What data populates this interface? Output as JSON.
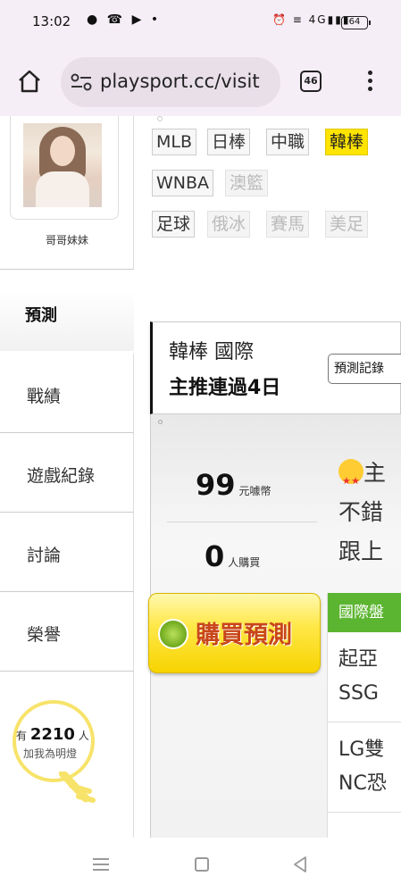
{
  "status_bar": {
    "time": "13:02",
    "left_icons": [
      "chat-icon",
      "missed-call-icon",
      "youtube-icon",
      "dot-icon"
    ],
    "right_icons": [
      "alarm-icon",
      "volte-icon",
      "signal-icon"
    ],
    "network": "4G",
    "battery": "64"
  },
  "browser": {
    "url": "playsport.cc/visit",
    "tab_count": "46"
  },
  "profile": {
    "name": "哥哥妹妹"
  },
  "nav": {
    "active": "預測",
    "items": [
      {
        "label": "戰績"
      },
      {
        "label": "遊戲紀錄"
      },
      {
        "label": "討論"
      },
      {
        "label": "榮譽"
      }
    ]
  },
  "fans": {
    "prefix": "有",
    "count": "2210",
    "unit": "人",
    "caption": "加我為明燈"
  },
  "league_tags": {
    "row1": [
      "MLB",
      "日棒",
      "中職",
      "韓棒"
    ],
    "row2": [
      "WNBA",
      "澳籃"
    ],
    "row3": [
      "足球",
      "俄冰",
      "賽馬",
      "美足"
    ],
    "active": "韓棒"
  },
  "ranking": {
    "title": "韓棒 國際",
    "streak": "主推連過4日",
    "record_button": "預測記錄"
  },
  "stats": {
    "coins": "99",
    "coins_unit": "元噱幣",
    "buyers": "0",
    "buyers_unit": "人購買"
  },
  "buy": {
    "icon_text": "噱",
    "label": "購買預測"
  },
  "post": {
    "line1": "主",
    "line2": "不錯",
    "line3": "跟上"
  },
  "market": {
    "header": "國際盤",
    "items": [
      {
        "line1": "起亞",
        "line2": "SSG"
      },
      {
        "line1": "LG雙",
        "line2": "NC恐"
      }
    ]
  },
  "colors": {
    "active_tag": "#ffe400",
    "market_header": "#5cb531",
    "buy_button": "#ffe84a",
    "buy_text": "#c8461a"
  }
}
